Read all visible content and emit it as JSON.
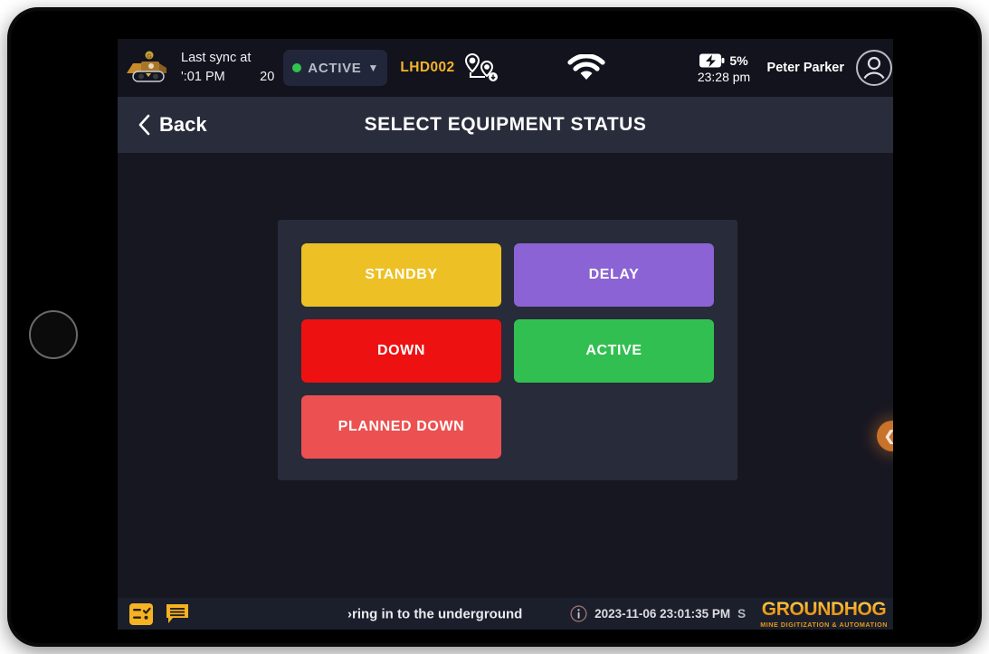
{
  "topbar": {
    "equipment_logo_icon": "mining-loader-icon",
    "sync_label": "Last sync at",
    "sync_time": "':01 PM",
    "sync_extra": "20",
    "status_pill": {
      "label": "ACTIVE",
      "dot_color": "#2fc44c",
      "chevron_icon": "chevron-down-icon"
    },
    "equipment_id": "LHD002",
    "route_icon": "route-pins-icon",
    "wifi_icon": "wifi-icon",
    "battery": {
      "icon": "battery-charging-icon",
      "percent": "5%",
      "time": "23:28 pm"
    },
    "user_name": "Peter Parker",
    "avatar_icon": "user-avatar-icon"
  },
  "titlebar": {
    "back_icon": "chevron-left-icon",
    "back_label": "Back",
    "title": "SELECT EQUIPMENT STATUS"
  },
  "status_options": [
    {
      "label": "STANDBY",
      "color": "#edc125"
    },
    {
      "label": "DELAY",
      "color": "#8b63d4"
    },
    {
      "label": "DOWN",
      "color": "#ee1111"
    },
    {
      "label": "ACTIVE",
      "color": "#32bf52"
    },
    {
      "label": "PLANNED DOWN",
      "color": "#ec5050"
    }
  ],
  "side_fab": {
    "icon": "collapse-arrow-icon",
    "color": "#c8722a"
  },
  "footer": {
    "checklist_icon": "checklist-icon",
    "chat_icon": "chat-message-icon",
    "marquee_text": "›ring in to the underground",
    "info_icon": "info-circle-icon",
    "timestamp": "2023-11-06 23:01:35 PM",
    "trailing_char": "S",
    "brand_name": "GROUNDHOG",
    "brand_tagline": "MINE DIGITIZATION & AUTOMATION"
  },
  "device": {
    "home_button_icon": "home-button-icon"
  }
}
